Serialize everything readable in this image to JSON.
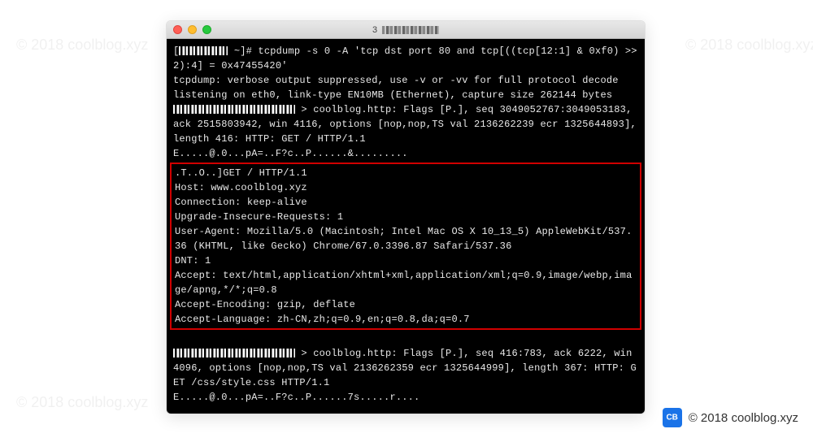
{
  "watermark_text": "© 2018 coolblog.xyz",
  "window": {
    "title_prefix": "3"
  },
  "terminal": {
    "prompt_suffix": "~]# ",
    "cmd": "tcpdump -s 0 -A 'tcp dst port 80 and tcp[((tcp[12:1] & 0xf0) >> 2):4] = 0x47455420'",
    "line2": "tcpdump: verbose output suppressed, use -v or -vv for full protocol decode",
    "line3": "listening on eth0, link-type EN10MB (Ethernet), capture size 262144 bytes",
    "line4_mid": " > coolblog.http: Flags [P.], seq 3049052767:3049053183, ack 2515803942, win 4116, options [nop,nop,TS val 2136262239 ecr 1325644893], length 416: HTTP: GET / HTTP/1.1",
    "line5": "E.....@.0...pA=..F?c..P......&.........",
    "http": {
      "l1": ".T..O..]GET / HTTP/1.1",
      "l2": "Host: www.coolblog.xyz",
      "l3": "Connection: keep-alive",
      "l4": "Upgrade-Insecure-Requests: 1",
      "l5": "User-Agent: Mozilla/5.0 (Macintosh; Intel Mac OS X 10_13_5) AppleWebKit/537.36 (KHTML, like Gecko) Chrome/67.0.3396.87 Safari/537.36",
      "l6": "DNT: 1",
      "l7": "Accept: text/html,application/xhtml+xml,application/xml;q=0.9,image/webp,image/apng,*/*;q=0.8",
      "l8": "Accept-Encoding: gzip, deflate",
      "l9": "Accept-Language: zh-CN,zh;q=0.9,en;q=0.8,da;q=0.7"
    },
    "line_after_blank": "",
    "line6_mid": " > coolblog.http: Flags [P.], seq 416:783, ack 6222, win 4096, options [nop,nop,TS val 2136262359 ecr 1325644999], length 367: HTTP: GET /css/style.css HTTP/1.1",
    "line7": "E.....@.0...pA=..F?c..P......7s.....r...."
  },
  "footer": {
    "logo_text": "CB",
    "copyright": "© 2018 coolblog.xyz"
  }
}
